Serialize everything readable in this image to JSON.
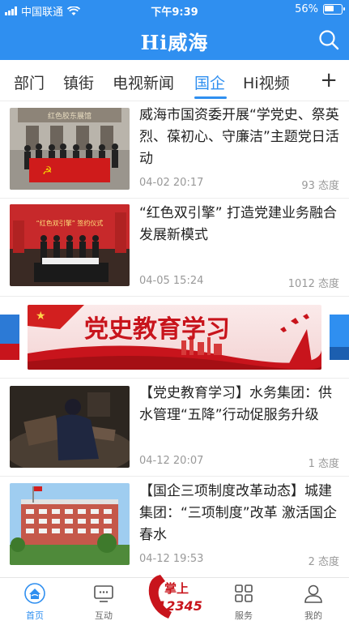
{
  "status": {
    "carrier": "中国联通",
    "time": "下午9:39",
    "battery": "56%"
  },
  "header": {
    "title": "Hi威海"
  },
  "tabs": [
    {
      "label": "部门"
    },
    {
      "label": "镇街"
    },
    {
      "label": "电视新闻"
    },
    {
      "label": "国企"
    },
    {
      "label": "Hi视频"
    }
  ],
  "active_tab": "国企",
  "add_label": "+",
  "articles": [
    {
      "title": "威海市国资委开展“学党史、祭英烈、葆初心、守廉洁”主题党日活动",
      "date": "04-02 20:17",
      "likes": "93 态度",
      "thumb_text": "红色胶东展馆"
    },
    {
      "title": "“红色双引擎” 打造党建业务融合发展新模式",
      "date": "04-05 15:24",
      "likes": "1012 态度",
      "thumb_text": "“红色双引擎” 签约仪式"
    },
    {
      "title": "【党史教育学习】水务集团：供水管理“五降”行动促服务升级",
      "date": "04-12 20:07",
      "likes": "1 态度"
    },
    {
      "title": "【国企三项制度改革动态】城建集团：“三项制度”改革 激活国企春水",
      "date": "04-12 19:53",
      "likes": "2 态度"
    }
  ],
  "banner": {
    "text": "党史教育学习"
  },
  "tabbar": [
    {
      "label": "首页",
      "icon": "home-icon"
    },
    {
      "label": "互动",
      "icon": "monitor-icon"
    },
    {
      "label": "服务",
      "icon": "grid-icon"
    },
    {
      "label": "我的",
      "icon": "user-icon"
    }
  ],
  "center_button": {
    "line1": "掌上",
    "line2": "12345"
  },
  "colors": {
    "primary": "#2f8ff0",
    "text": "#222222",
    "meta": "#999999",
    "banner_red": "#c8141c"
  }
}
